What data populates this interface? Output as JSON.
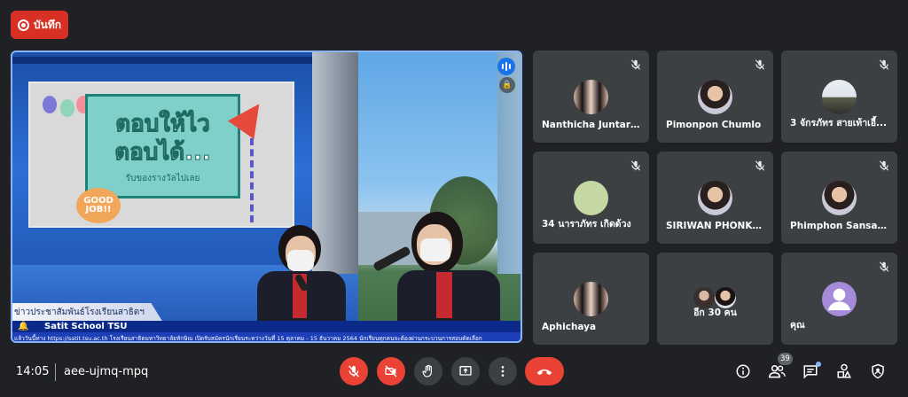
{
  "record_button": {
    "label": "บันทึก",
    "color": "#d93025"
  },
  "main_stage": {
    "slide": {
      "title_line1": "ตอบให้ไว",
      "title_line2": "ตอบได้...",
      "subtitle": "รับของรางวัลไปเลย",
      "badge": "GOOD JOB!!"
    },
    "news_label": "ข่าวประชาสัมพันธ์โรงเรียนสาธิตฯ",
    "school_name": "Satit School TSU",
    "ticker": "แล้ววันนี้ทาง https://satit.tsu.ac.th โรงเรียนสาธิตมหาวิทยาลัยทักษิณ เปิดรับสมัครนักเรียนระหว่างวันที่ 15 ตุลาคม - 15 ธันวาคม 2564 นักเรียนทุกคนจะต้องผ่านกระบวนการสอบคัดเลือก",
    "highlight_color": "#8ab4f8"
  },
  "participants": [
    {
      "name": "Nanthicha Juntara...",
      "muted": true,
      "avatar": "photo-two-people"
    },
    {
      "name": "Pimonpon Chumlo",
      "muted": true,
      "avatar": "photo-person"
    },
    {
      "name": "3 จักรภัทร สายเท้าเอี้...",
      "muted": true,
      "avatar": "photo-outdoor"
    },
    {
      "name": "34 นาราภัทร เกิดด้วง",
      "muted": true,
      "avatar": "plain-circle"
    },
    {
      "name": "SIRIWAN PHONKA...",
      "muted": true,
      "avatar": "photo-person"
    },
    {
      "name": "Phimphon Sansawek",
      "muted": true,
      "avatar": "photo-person"
    },
    {
      "name": "Aphichaya",
      "muted": false,
      "avatar": "photo-two-people"
    },
    {
      "name": "อีก 30 คน",
      "muted": false,
      "avatar": "photo-stack"
    },
    {
      "name": "คุณ",
      "muted": true,
      "avatar": "default-person"
    }
  ],
  "bottom_bar": {
    "time": "14:05",
    "meeting_code": "aee-ujmq-mpq",
    "participant_count": "39",
    "controls": [
      "mic-off-icon",
      "camera-off-icon",
      "raise-hand-icon",
      "present-icon",
      "more-options-icon",
      "end-call-icon"
    ],
    "right_icons": [
      "info-icon",
      "people-icon",
      "chat-icon",
      "activities-icon",
      "host-controls-icon"
    ]
  }
}
